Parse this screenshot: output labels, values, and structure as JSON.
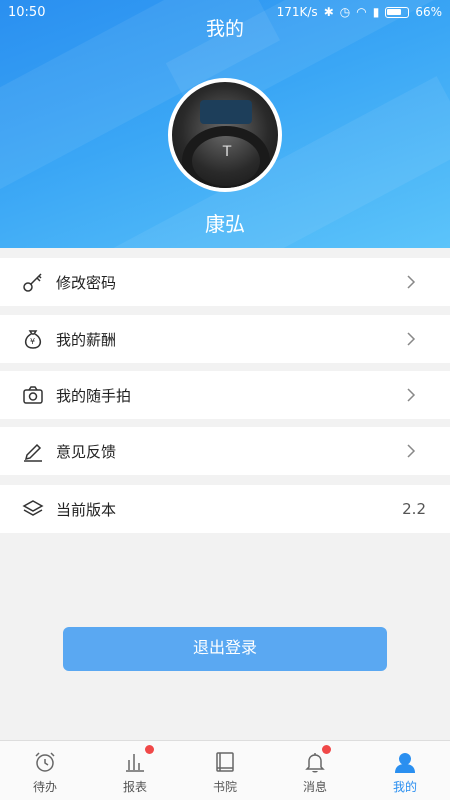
{
  "status_bar": {
    "time": "10:50",
    "net_speed": "171K/s",
    "battery": "66%"
  },
  "header": {
    "title": "我的",
    "user_name": "康弘"
  },
  "menu": {
    "change_password": "修改密码",
    "my_salary": "我的薪酬",
    "my_snapshots": "我的随手拍",
    "feedback": "意见反馈",
    "current_version": "当前版本",
    "version_value": "2.2"
  },
  "logout_label": "退出登录",
  "tabs": {
    "todo": "待办",
    "reports": "报表",
    "library": "书院",
    "messages": "消息",
    "mine": "我的"
  },
  "colors": {
    "accent": "#2a8ff0",
    "button": "#5aa8f2",
    "badge": "#f04848"
  }
}
